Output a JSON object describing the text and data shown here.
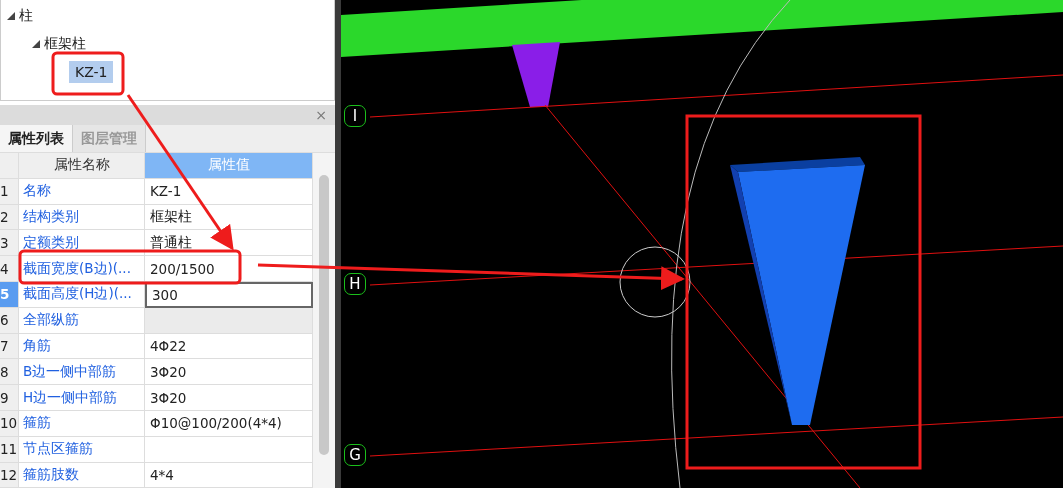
{
  "tree": [
    {
      "label": "柱",
      "expanded": true,
      "selected": false,
      "children": [
        {
          "label": "框架柱",
          "expanded": true,
          "selected": false,
          "children": [
            {
              "label": "KZ-1",
              "selected": true
            }
          ]
        }
      ]
    }
  ],
  "tabs": [
    {
      "label": "属性列表",
      "selected": true
    },
    {
      "label": "图层管理",
      "selected": false
    }
  ],
  "close_label": "×",
  "table": {
    "columns": [
      "属性名称",
      "属性值"
    ],
    "rows": [
      {
        "index": "1",
        "name": "名称",
        "value": "KZ-1",
        "selected": false,
        "readonly": false
      },
      {
        "index": "2",
        "name": "结构类别",
        "value": "框架柱",
        "selected": false,
        "readonly": false
      },
      {
        "index": "3",
        "name": "定额类别",
        "value": "普通柱",
        "selected": false,
        "readonly": false
      },
      {
        "index": "4",
        "name": "截面宽度(B边)(...",
        "value": "200/1500",
        "selected": false,
        "readonly": false
      },
      {
        "index": "5",
        "name": "截面高度(H边)(...",
        "value": "300",
        "selected": true,
        "readonly": false
      },
      {
        "index": "6",
        "name": "全部纵筋",
        "value": "",
        "selected": false,
        "readonly": true
      },
      {
        "index": "7",
        "name": "角筋",
        "value": "4Φ22",
        "selected": false,
        "readonly": false
      },
      {
        "index": "8",
        "name": "B边一侧中部筋",
        "value": "3Φ20",
        "selected": false,
        "readonly": false
      },
      {
        "index": "9",
        "name": "H边一侧中部筋",
        "value": "3Φ20",
        "selected": false,
        "readonly": false
      },
      {
        "index": "10",
        "name": "箍筋",
        "value": "Φ10@100/200(4*4)",
        "selected": false,
        "readonly": false
      },
      {
        "index": "11",
        "name": "节点区箍筋",
        "value": "",
        "selected": false,
        "readonly": false
      },
      {
        "index": "12",
        "name": "箍筋肢数",
        "value": "4*4",
        "selected": false,
        "readonly": false
      }
    ]
  },
  "axis_labels": [
    "I",
    "H",
    "G"
  ]
}
